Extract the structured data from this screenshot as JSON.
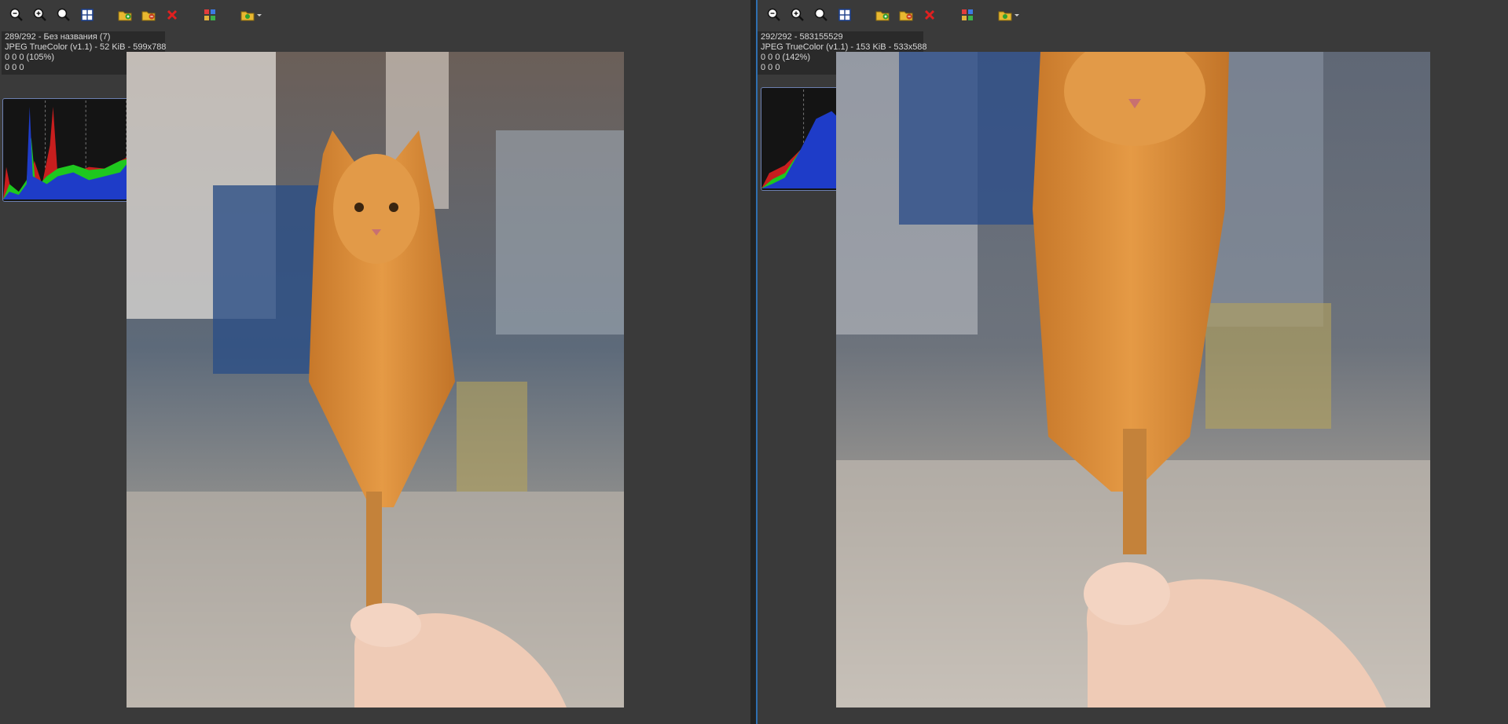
{
  "panes": [
    {
      "toolbar": {
        "buttons": [
          {
            "icon": "zoom-out-icon"
          },
          {
            "icon": "zoom-in-icon"
          },
          {
            "icon": "zoom-actual-icon"
          },
          {
            "icon": "fit-window-icon"
          },
          {
            "icon": "open-folder-icon"
          },
          {
            "icon": "move-folder-icon"
          },
          {
            "icon": "delete-icon"
          },
          {
            "icon": "thumbnails-icon"
          },
          {
            "icon": "folder-dropdown-icon"
          }
        ]
      },
      "info": {
        "line1": "289/292 - Без названия (7)",
        "line2": "JPEG TrueColor (v1.1) - 52 KiB - 599x788",
        "line3": "0 0 0 (105%)",
        "line4": "0 0 0"
      },
      "colors": {
        "border": "#3a3a3a"
      }
    },
    {
      "toolbar": {
        "buttons": [
          {
            "icon": "zoom-out-icon"
          },
          {
            "icon": "zoom-in-icon"
          },
          {
            "icon": "zoom-actual-icon"
          },
          {
            "icon": "fit-window-icon"
          },
          {
            "icon": "open-folder-icon"
          },
          {
            "icon": "move-folder-icon"
          },
          {
            "icon": "delete-icon"
          },
          {
            "icon": "thumbnails-icon"
          },
          {
            "icon": "folder-dropdown-icon"
          }
        ]
      },
      "info": {
        "line1": "292/292 - 583155529",
        "line2": "JPEG TrueColor (v1.1) - 153 KiB - 533x588",
        "line3": "0 0 0 (142%)",
        "line4": "0 0 0"
      },
      "colors": {
        "border": "#2f6fb0"
      }
    }
  ],
  "colors": {
    "background": "#3a3a3a",
    "histogram_red": "#c81e1e",
    "histogram_green": "#1ec81e",
    "histogram_blue": "#1e3cc8"
  }
}
